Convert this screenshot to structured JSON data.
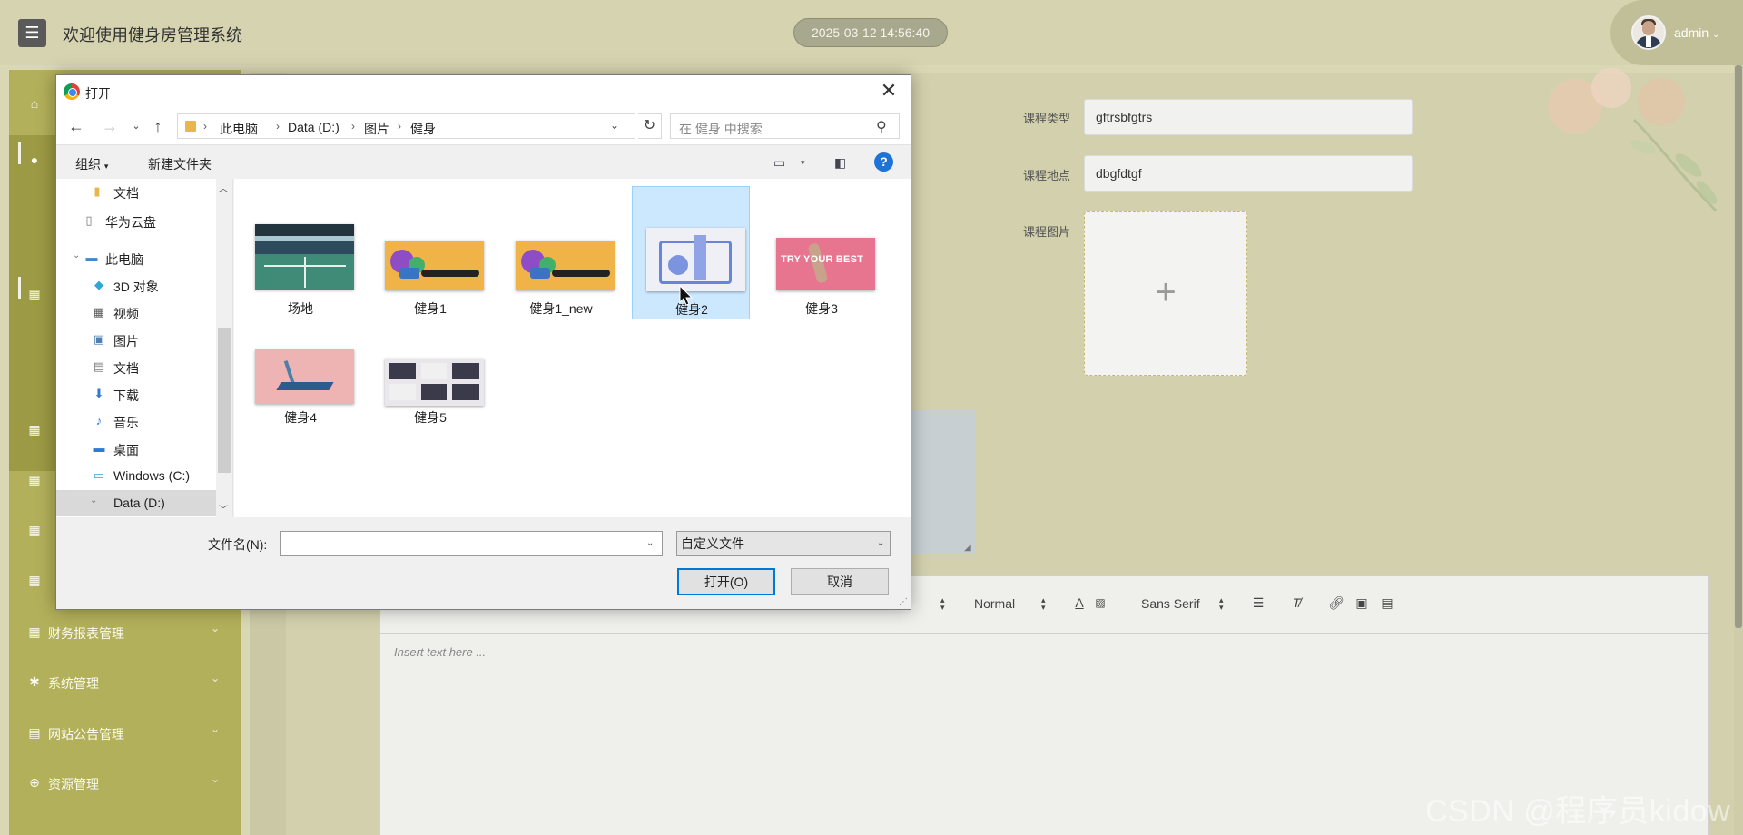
{
  "app": {
    "menu_icon": "hamburger-icon",
    "title": "欢迎使用健身房管理系统",
    "datetime": "2025-03-12 14:56:40",
    "user": "admin"
  },
  "sidebar": {
    "items": [
      {
        "label": "财务报表管理",
        "icon": "grid-icon"
      },
      {
        "label": "系统管理",
        "icon": "gear-icon"
      },
      {
        "label": "网站公告管理",
        "icon": "document-icon"
      },
      {
        "label": "资源管理",
        "icon": "plus-circle-icon"
      }
    ]
  },
  "form": {
    "course_type_label": "课程类型",
    "course_type_value": "gftrsbfgtrs",
    "course_location_label": "课程地点",
    "course_location_value": "dbgfdtgf",
    "course_image_label": "课程图片"
  },
  "editor": {
    "size_value": "Normal",
    "font_value": "Sans Serif",
    "placeholder": "Insert text here ..."
  },
  "dialog": {
    "title": "打开",
    "breadcrumb": [
      "此电脑",
      "Data (D:)",
      "图片",
      "健身"
    ],
    "search_placeholder": "在 健身 中搜索",
    "organize_label": "组织",
    "new_folder_label": "新建文件夹",
    "nav_items": [
      {
        "label": "文档",
        "icon": "folder-icon"
      },
      {
        "label": "华为云盘",
        "icon": "cloud-drive-icon"
      },
      {
        "label": "此电脑",
        "icon": "computer-icon"
      },
      {
        "label": "3D 对象",
        "icon": "cube-icon"
      },
      {
        "label": "视频",
        "icon": "film-icon"
      },
      {
        "label": "图片",
        "icon": "picture-icon"
      },
      {
        "label": "文档",
        "icon": "document-icon"
      },
      {
        "label": "下载",
        "icon": "download-arrow-icon"
      },
      {
        "label": "音乐",
        "icon": "music-note-icon"
      },
      {
        "label": "桌面",
        "icon": "desktop-icon"
      },
      {
        "label": "Windows (C:)",
        "icon": "drive-icon"
      },
      {
        "label": "Data (D:)",
        "icon": "drive-icon"
      }
    ],
    "files": [
      {
        "name": "场地"
      },
      {
        "name": "健身1"
      },
      {
        "name": "健身1_new"
      },
      {
        "name": "健身2"
      },
      {
        "name": "健身3"
      },
      {
        "name": "健身4"
      },
      {
        "name": "健身5"
      }
    ],
    "thumb_text_3": "TRY YOUR BEST",
    "filename_label": "文件名(N):",
    "filename_value": "",
    "filetype_value": "自定义文件",
    "open_button": "打开(O)",
    "cancel_button": "取消"
  },
  "watermark": "CSDN @程序员kidow",
  "colors": {
    "accent_blue": "#0078d7",
    "sidebar": "#b2b05a",
    "background": "#dad8b4"
  }
}
